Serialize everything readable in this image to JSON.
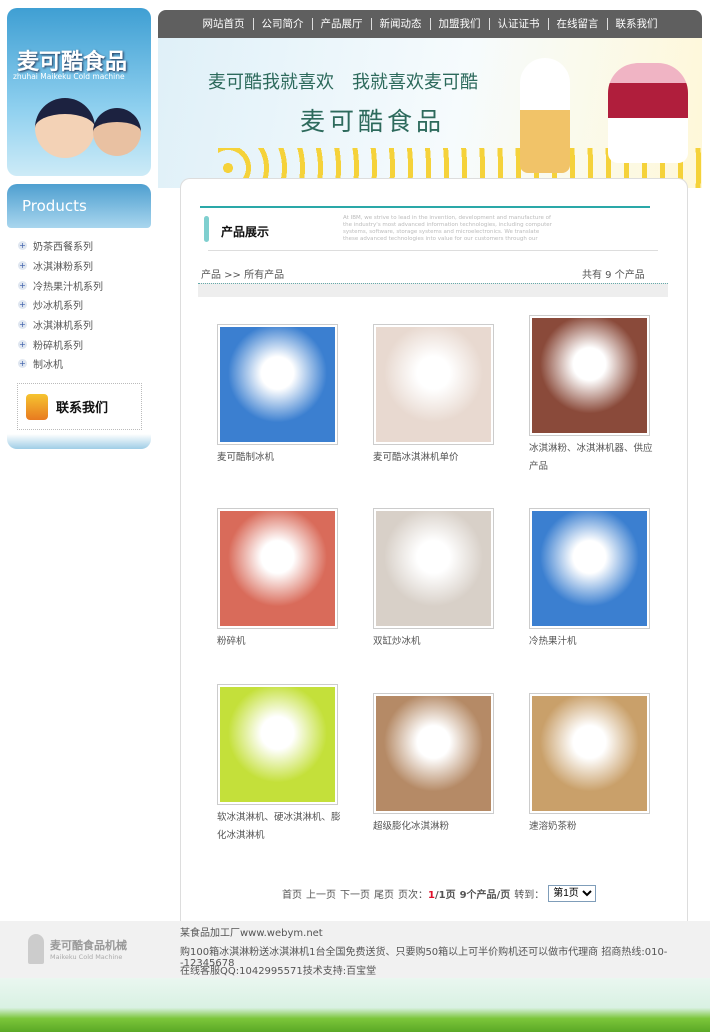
{
  "logo": {
    "title": "麦可酷食品",
    "subtitle": "zhuhai Maikeku Cold machine"
  },
  "nav": [
    "网站首页",
    "公司简介",
    "产品展厅",
    "新闻动态",
    "加盟我们",
    "认证证书",
    "在线留言",
    "联系我们"
  ],
  "banner": {
    "slogan": "麦可酷我就喜欢　我就喜欢麦可酷",
    "title": "麦可酷食品"
  },
  "sidebar": {
    "header": "Products",
    "categories": [
      "奶茶西餐系列",
      "冰淇淋粉系列",
      "冷热果汁机系列",
      "炒冰机系列",
      "冰淇淋机系列",
      "粉碎机系列",
      "制冰机"
    ],
    "contact": "联系我们"
  },
  "main": {
    "title": "产品展示",
    "intro": "At IBM, we strive to lead in the invention, development and manufacture of the industry's most advanced information technologies, including computer systems, software, storage systems and microelectronics. We translate these advanced technologies into value for our customers through our",
    "breadcrumb": "产品 >> 所有产品",
    "count": "共有 9 个产品",
    "products": [
      {
        "name": "麦可酷制冰机",
        "color": "#3b7fd0"
      },
      {
        "name": "麦可酷冰淇淋机单价",
        "color": "#e8d9d0"
      },
      {
        "name": "冰淇淋粉、冰淇淋机器、供应产品",
        "color": "#8a4a3a"
      },
      {
        "name": "粉碎机",
        "color": "#d96b5a"
      },
      {
        "name": "双缸炒冰机",
        "color": "#d8d0c8"
      },
      {
        "name": "冷热果汁机",
        "color": "#3b7fd0"
      },
      {
        "name": "软冰淇淋机、硬冰淇淋机、膨化冰淇淋机",
        "color": "#c4e03a"
      },
      {
        "name": "超级膨化冰淇淋粉",
        "color": "#b58a66"
      },
      {
        "name": "速溶奶茶粉",
        "color": "#c9a06a"
      }
    ]
  },
  "pager": {
    "first": "首页",
    "prev": "上一页",
    "next": "下一页",
    "last": "尾页",
    "page_label": "页次：",
    "current": "1",
    "total": "/1页",
    "per_page": "9个产品/页",
    "goto": "转到：",
    "select": "第1页"
  },
  "footer": {
    "logo_cn": "麦可酷食品机械",
    "logo_en": "Maikeku Cold Machine",
    "line1": "某食品加工厂www.webym.net",
    "line2": "购100箱冰淇淋粉送冰淇淋机1台全国免费送货、只要购50箱以上可半价购机还可以做市代理商 招商热线:010--12345678",
    "line3": "在线客服QQ:1042995571技术支持:百宝堂"
  }
}
